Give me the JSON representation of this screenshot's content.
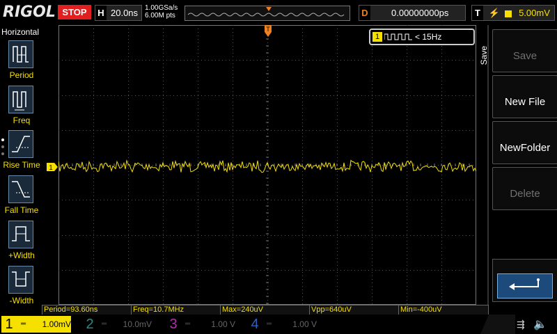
{
  "topbar": {
    "brand": "RIGOL",
    "run_state": "STOP",
    "horizontal_key": "H",
    "timebase": "20.0ns",
    "sample_rate": "1.00GSa/s",
    "memory_depth": "6.00M pts",
    "delay_key": "D",
    "delay": "0.00000000ps",
    "trigger_key": "T",
    "trigger_level": "5.00mV"
  },
  "left_menu": {
    "title": "Horizontal",
    "items": [
      {
        "label": "Period",
        "icon": "period-icon"
      },
      {
        "label": "Freq",
        "icon": "freq-icon"
      },
      {
        "label": "Rise Time",
        "icon": "rise-time-icon"
      },
      {
        "label": "Fall Time",
        "icon": "fall-time-icon"
      },
      {
        "label": "+Width",
        "icon": "positive-width-icon"
      },
      {
        "label": "-Width",
        "icon": "negative-width-icon"
      }
    ]
  },
  "right_menu": {
    "tab": "Save",
    "buttons": [
      {
        "label": "Save",
        "enabled": false
      },
      {
        "label": "New File",
        "enabled": true
      },
      {
        "label": "NewFolder",
        "enabled": true
      },
      {
        "label": "Delete",
        "enabled": false
      }
    ],
    "back_icon": "return-arrow-icon"
  },
  "freq_counter": {
    "channel": "1",
    "text": "< 15Hz"
  },
  "channel1_marker": "1",
  "measurements": [
    "Period=93.60ns",
    "Freq=10.7MHz",
    "Max=240uV",
    "Vpp=640uV",
    "Min=-400uV"
  ],
  "channels": [
    {
      "num": "1",
      "scale": "1.00mV",
      "color": "#f5e000"
    },
    {
      "num": "2",
      "scale": "10.0mV",
      "color": "#2a8a8a"
    },
    {
      "num": "3",
      "scale": "1.00 V",
      "color": "#b030b0"
    },
    {
      "num": "4",
      "scale": "1.00 V",
      "color": "#3060c0"
    }
  ],
  "status_icons": [
    "usb-icon",
    "speaker-mute-icon"
  ],
  "colors": {
    "trace": "#f5e000",
    "trigger": "#f08020",
    "stop": "#e02020",
    "grid": "#555555"
  }
}
